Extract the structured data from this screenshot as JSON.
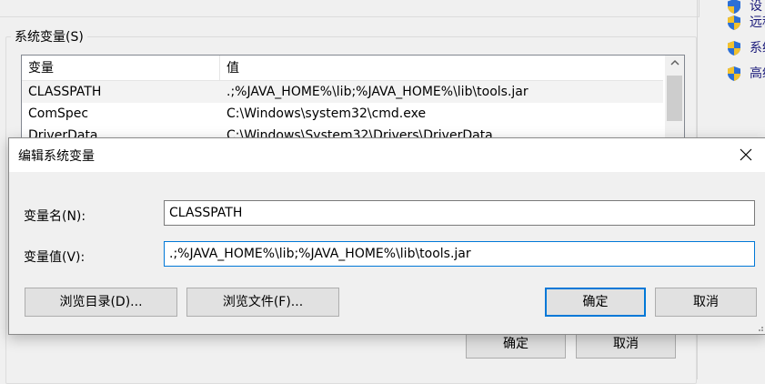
{
  "background_window": {
    "group_label": "系统变量(S)",
    "columns": [
      "变量",
      "值"
    ],
    "rows": [
      {
        "name": "CLASSPATH",
        "value": ".;%JAVA_HOME%\\lib;%JAVA_HOME%\\lib\\tools.jar",
        "selected": true
      },
      {
        "name": "ComSpec",
        "value": "C:\\Windows\\system32\\cmd.exe",
        "selected": false
      },
      {
        "name": "DriverData",
        "value": "C:\\Windows\\System32\\Drivers\\DriverData",
        "selected": false
      }
    ],
    "ok_label": "确定",
    "cancel_label": "取消"
  },
  "side_panel": {
    "items": [
      {
        "icon": "uac-shield-icon",
        "label": "设"
      },
      {
        "icon": "uac-shield-icon",
        "label": "远程"
      },
      {
        "icon": "uac-shield-icon",
        "label": "系统"
      },
      {
        "icon": "uac-shield-icon",
        "label": "高级"
      }
    ]
  },
  "dialog": {
    "title": "编辑系统变量",
    "close_icon": "close-icon",
    "name_label": "变量名(N):",
    "name_value": "CLASSPATH",
    "value_label": "变量值(V):",
    "value_value": ".;%JAVA_HOME%\\lib;%JAVA_HOME%\\lib\\tools.jar",
    "browse_dir_label": "浏览目录(D)...",
    "browse_file_label": "浏览文件(F)...",
    "ok_label": "确定",
    "cancel_label": "取消"
  },
  "colors": {
    "focus_accent": "#0078d7",
    "selection": "#f3f3f3",
    "window_bg": "#f0f0f0"
  }
}
